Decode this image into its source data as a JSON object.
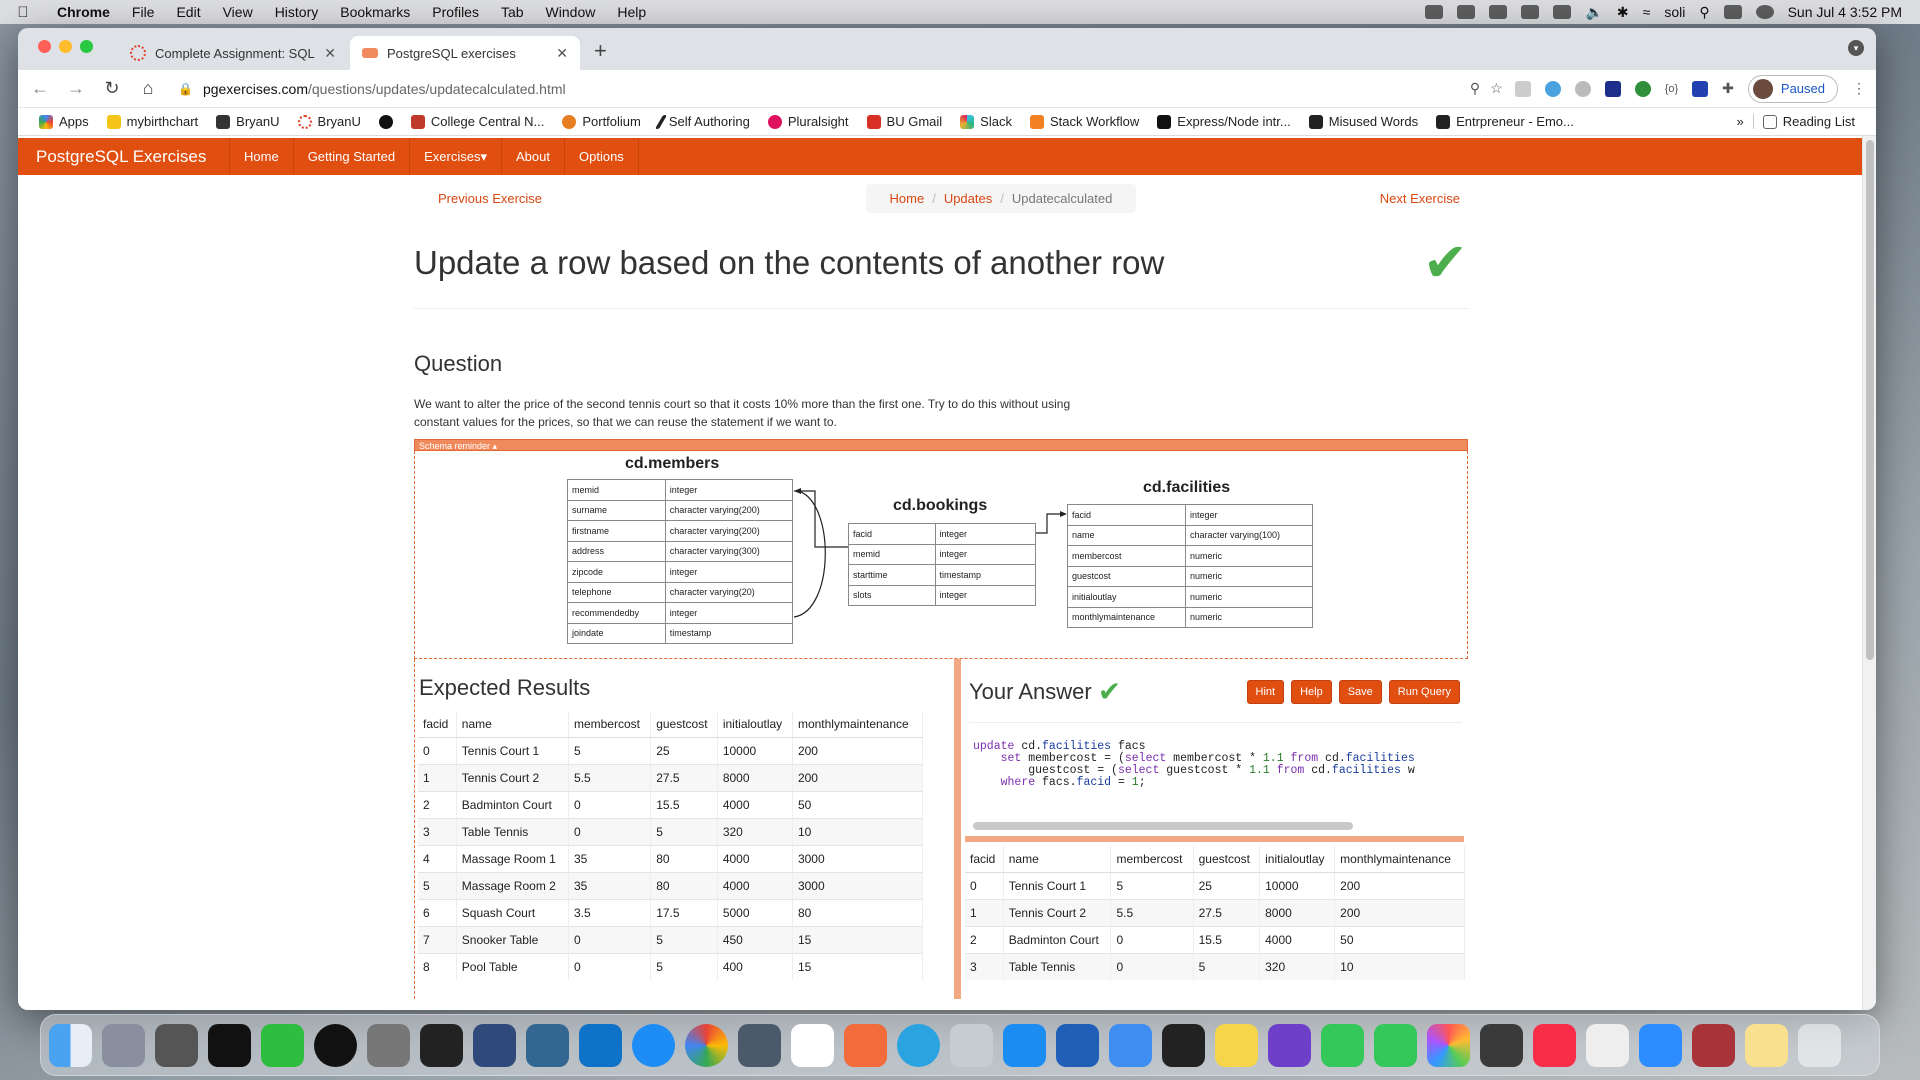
{
  "menubar": {
    "app": "Chrome",
    "items": [
      "File",
      "Edit",
      "View",
      "History",
      "Bookmarks",
      "Profiles",
      "Tab",
      "Window",
      "Help"
    ],
    "user": "soli",
    "clock": "Sun Jul 4  3:52 PM"
  },
  "browser": {
    "tabs": [
      {
        "title": "Complete Assignment: SQL Pr",
        "active": false
      },
      {
        "title": "PostgreSQL exercises",
        "active": true
      }
    ],
    "url_host": "pgexercises.com",
    "url_path": "/questions/updates/updatecalculated.html",
    "profile_status": "Paused",
    "bookmarks": [
      "Apps",
      "mybirthchart",
      "BryanU",
      "BryanU",
      "",
      "College Central N...",
      "Portfolium",
      "Self Authoring",
      "Pluralsight",
      "BU Gmail",
      "Slack",
      "Stack Workflow",
      "Express/Node intr...",
      "Misused Words",
      "Entrpreneur - Emo..."
    ],
    "reading_list": "Reading List",
    "more_bookmarks": "»"
  },
  "site": {
    "brand": "PostgreSQL Exercises",
    "nav": [
      "Home",
      "Getting Started",
      "Exercises▾",
      "About",
      "Options"
    ],
    "prev": "Previous Exercise",
    "next": "Next Exercise",
    "breadcrumb": [
      "Home",
      "Updates",
      "Updatecalculated"
    ],
    "title": "Update a row based on the contents of another row",
    "question_heading": "Question",
    "question_text": "We want to alter the price of the second tennis court so that it costs 10% more than the first one. Try to do this without using constant values for the prices, so that we can reuse the statement if we want to.",
    "schema_label": "Schema reminder ▴"
  },
  "schema": {
    "members": {
      "title": "cd.members",
      "rows": [
        [
          "memid",
          "integer"
        ],
        [
          "surname",
          "character varying(200)"
        ],
        [
          "firstname",
          "character varying(200)"
        ],
        [
          "address",
          "character varying(300)"
        ],
        [
          "zipcode",
          "integer"
        ],
        [
          "telephone",
          "character varying(20)"
        ],
        [
          "recommendedby",
          "integer"
        ],
        [
          "joindate",
          "timestamp"
        ]
      ]
    },
    "bookings": {
      "title": "cd.bookings",
      "rows": [
        [
          "facid",
          "integer"
        ],
        [
          "memid",
          "integer"
        ],
        [
          "starttime",
          "timestamp"
        ],
        [
          "slots",
          "integer"
        ]
      ]
    },
    "facilities": {
      "title": "cd.facilities",
      "rows": [
        [
          "facid",
          "integer"
        ],
        [
          "name",
          "character varying(100)"
        ],
        [
          "membercost",
          "numeric"
        ],
        [
          "guestcost",
          "numeric"
        ],
        [
          "initialoutlay",
          "numeric"
        ],
        [
          "monthlymaintenance",
          "numeric"
        ]
      ]
    }
  },
  "expected": {
    "heading": "Expected Results",
    "columns": [
      "facid",
      "name",
      "membercost",
      "guestcost",
      "initialoutlay",
      "monthlymaintenance"
    ],
    "rows": [
      [
        "0",
        "Tennis Court 1",
        "5",
        "25",
        "10000",
        "200"
      ],
      [
        "1",
        "Tennis Court 2",
        "5.5",
        "27.5",
        "8000",
        "200"
      ],
      [
        "2",
        "Badminton Court",
        "0",
        "15.5",
        "4000",
        "50"
      ],
      [
        "3",
        "Table Tennis",
        "0",
        "5",
        "320",
        "10"
      ],
      [
        "4",
        "Massage Room 1",
        "35",
        "80",
        "4000",
        "3000"
      ],
      [
        "5",
        "Massage Room 2",
        "35",
        "80",
        "4000",
        "3000"
      ],
      [
        "6",
        "Squash Court",
        "3.5",
        "17.5",
        "5000",
        "80"
      ],
      [
        "7",
        "Snooker Table",
        "0",
        "5",
        "450",
        "15"
      ],
      [
        "8",
        "Pool Table",
        "0",
        "5",
        "400",
        "15"
      ]
    ]
  },
  "answer": {
    "heading": "Your Answer",
    "buttons": [
      "Hint",
      "Help",
      "Save",
      "Run Query"
    ],
    "code_lines": [
      "update cd.facilities facs",
      "    set membercost = (select membercost * 1.1 from cd.facilities",
      "        guestcost = (select guestcost * 1.1 from cd.facilities w",
      "    where facs.facid = 1;"
    ],
    "columns": [
      "facid",
      "name",
      "membercost",
      "guestcost",
      "initialoutlay",
      "monthlymaintenance"
    ],
    "rows": [
      [
        "0",
        "Tennis Court 1",
        "5",
        "25",
        "10000",
        "200"
      ],
      [
        "1",
        "Tennis Court 2",
        "5.5",
        "27.5",
        "8000",
        "200"
      ],
      [
        "2",
        "Badminton Court",
        "0",
        "15.5",
        "4000",
        "50"
      ],
      [
        "3",
        "Table Tennis",
        "0",
        "5",
        "320",
        "10"
      ]
    ]
  },
  "colors": {
    "brand": "#e04e10",
    "success": "#4cae4c",
    "link": "#d94712"
  }
}
